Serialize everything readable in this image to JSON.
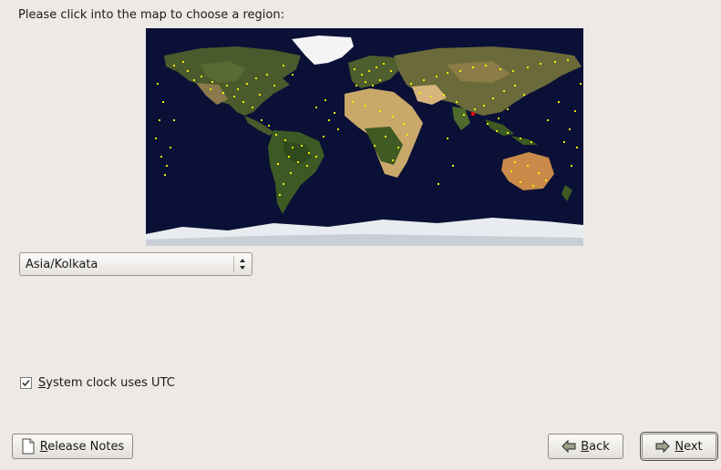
{
  "header": {
    "instruction": "Please click into the map to choose a region:"
  },
  "map": {
    "selected_city": "Kolkata",
    "ocean_color": "#0a1036",
    "marker_color": "#f3f000",
    "selected_marker_color": "#e01010"
  },
  "timezone": {
    "selected": "Asia/Kolkata"
  },
  "clock": {
    "utc_label_prefix": "S",
    "utc_label_rest": "ystem clock uses UTC",
    "utc_checked": true
  },
  "buttons": {
    "release_prefix": "R",
    "release_rest": "elease Notes",
    "back_prefix": "B",
    "back_rest": "ack",
    "next_prefix": "N",
    "next_rest": "ext"
  }
}
